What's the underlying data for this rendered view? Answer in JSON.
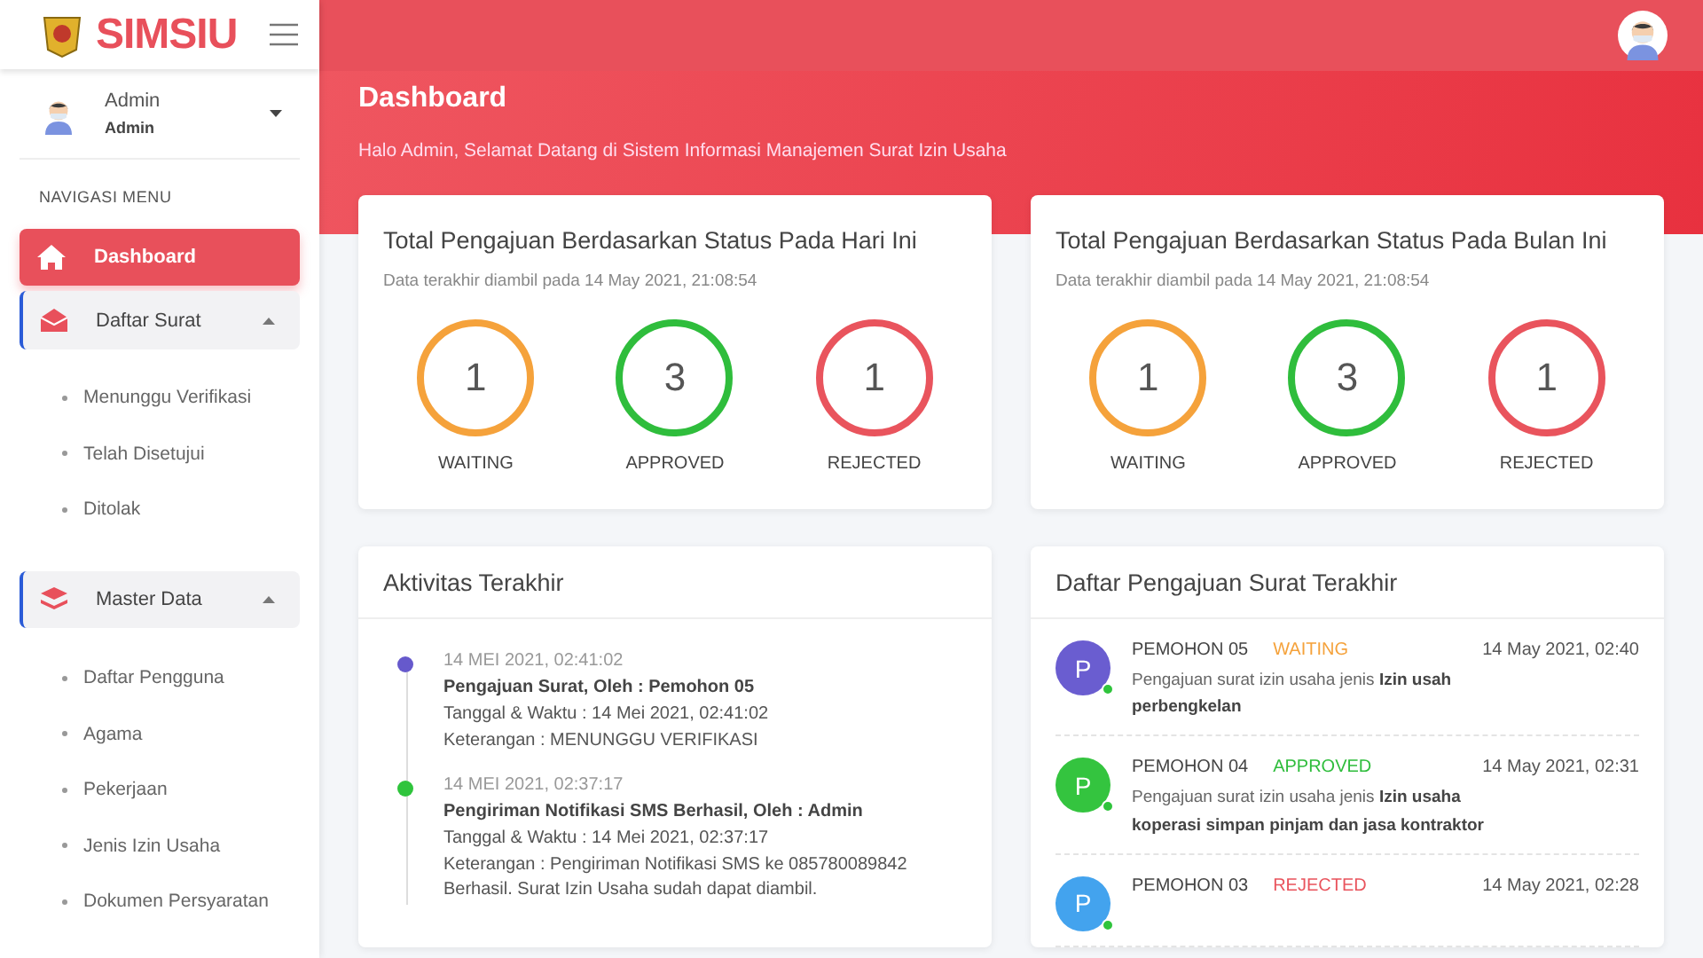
{
  "brand": {
    "name": "SIMSIU"
  },
  "user": {
    "name": "Admin",
    "role": "Admin"
  },
  "sidebar": {
    "heading": "NAVIGASI MENU",
    "items": [
      {
        "label": "Dashboard",
        "kind": "link",
        "selected": true
      },
      {
        "label": "Daftar Surat",
        "kind": "group",
        "expanded": true,
        "children": [
          {
            "label": "Menunggu Verifikasi"
          },
          {
            "label": "Telah Disetujui"
          },
          {
            "label": "Ditolak"
          }
        ]
      },
      {
        "label": "Master Data",
        "kind": "group",
        "expanded": true,
        "children": [
          {
            "label": "Daftar Pengguna"
          },
          {
            "label": "Agama"
          },
          {
            "label": "Pekerjaan"
          },
          {
            "label": "Jenis Izin Usaha"
          },
          {
            "label": "Dokumen Persyaratan"
          }
        ]
      }
    ]
  },
  "page": {
    "title": "Dashboard",
    "subtitle": "Halo Admin, Selamat Datang di Sistem Informasi Manajemen Surat Izin Usaha"
  },
  "stat_cards": [
    {
      "title": "Total Pengajuan Berdasarkan Status Pada Hari Ini",
      "updated": "Data terakhir diambil pada 14 May 2021, 21:08:54",
      "stats": [
        {
          "value": "1",
          "label": "WAITING",
          "color": "#f5a23b"
        },
        {
          "value": "3",
          "label": "APPROVED",
          "color": "#2fbd3c"
        },
        {
          "value": "1",
          "label": "REJECTED",
          "color": "#e9545d"
        }
      ]
    },
    {
      "title": "Total Pengajuan Berdasarkan Status Pada Bulan Ini",
      "updated": "Data terakhir diambil pada 14 May 2021, 21:08:54",
      "stats": [
        {
          "value": "1",
          "label": "WAITING",
          "color": "#f5a23b"
        },
        {
          "value": "3",
          "label": "APPROVED",
          "color": "#2fbd3c"
        },
        {
          "value": "1",
          "label": "REJECTED",
          "color": "#e9545d"
        }
      ]
    }
  ],
  "activity": {
    "title": "Aktivitas Terakhir",
    "items": [
      {
        "time": "14 MEI 2021, 02:41:02",
        "color": "#6659cc",
        "title": "Pengajuan Surat, Oleh : Pemohon 05",
        "lines": [
          "Tanggal & Waktu : 14 Mei 2021, 02:41:02",
          "Keterangan : MENUNGGU VERIFIKASI"
        ]
      },
      {
        "time": "14 MEI 2021, 02:37:17",
        "color": "#2fc43c",
        "title": "Pengiriman Notifikasi SMS Berhasil, Oleh : Admin",
        "lines": [
          "Tanggal & Waktu : 14 Mei 2021, 02:37:17",
          "Keterangan : Pengiriman Notifikasi SMS ke 085780089842 Berhasil. Surat Izin Usaha sudah dapat diambil."
        ]
      }
    ]
  },
  "requests": {
    "title": "Daftar Pengajuan Surat Terakhir",
    "items": [
      {
        "initial": "P",
        "color": "#6a5dd0",
        "name": "PEMOHON 05",
        "status": "WAITING",
        "kind": "waiting",
        "date": "14 May 2021, 02:40",
        "description": "Pengajuan surat izin usaha jenis **Izin usah perbengkelan**"
      },
      {
        "initial": "P",
        "color": "#34c43f",
        "name": "PEMOHON 04",
        "status": "APPROVED",
        "kind": "approved",
        "date": "14 May 2021, 02:31",
        "description": "Pengajuan surat izin usaha jenis **Izin usaha koperasi simpan pinjam dan jasa kontraktor**"
      },
      {
        "initial": "P",
        "color": "#43a3ee",
        "name": "PEMOHON 03",
        "status": "REJECTED",
        "kind": "rejected",
        "date": "14 May 2021, 02:28"
      }
    ]
  }
}
